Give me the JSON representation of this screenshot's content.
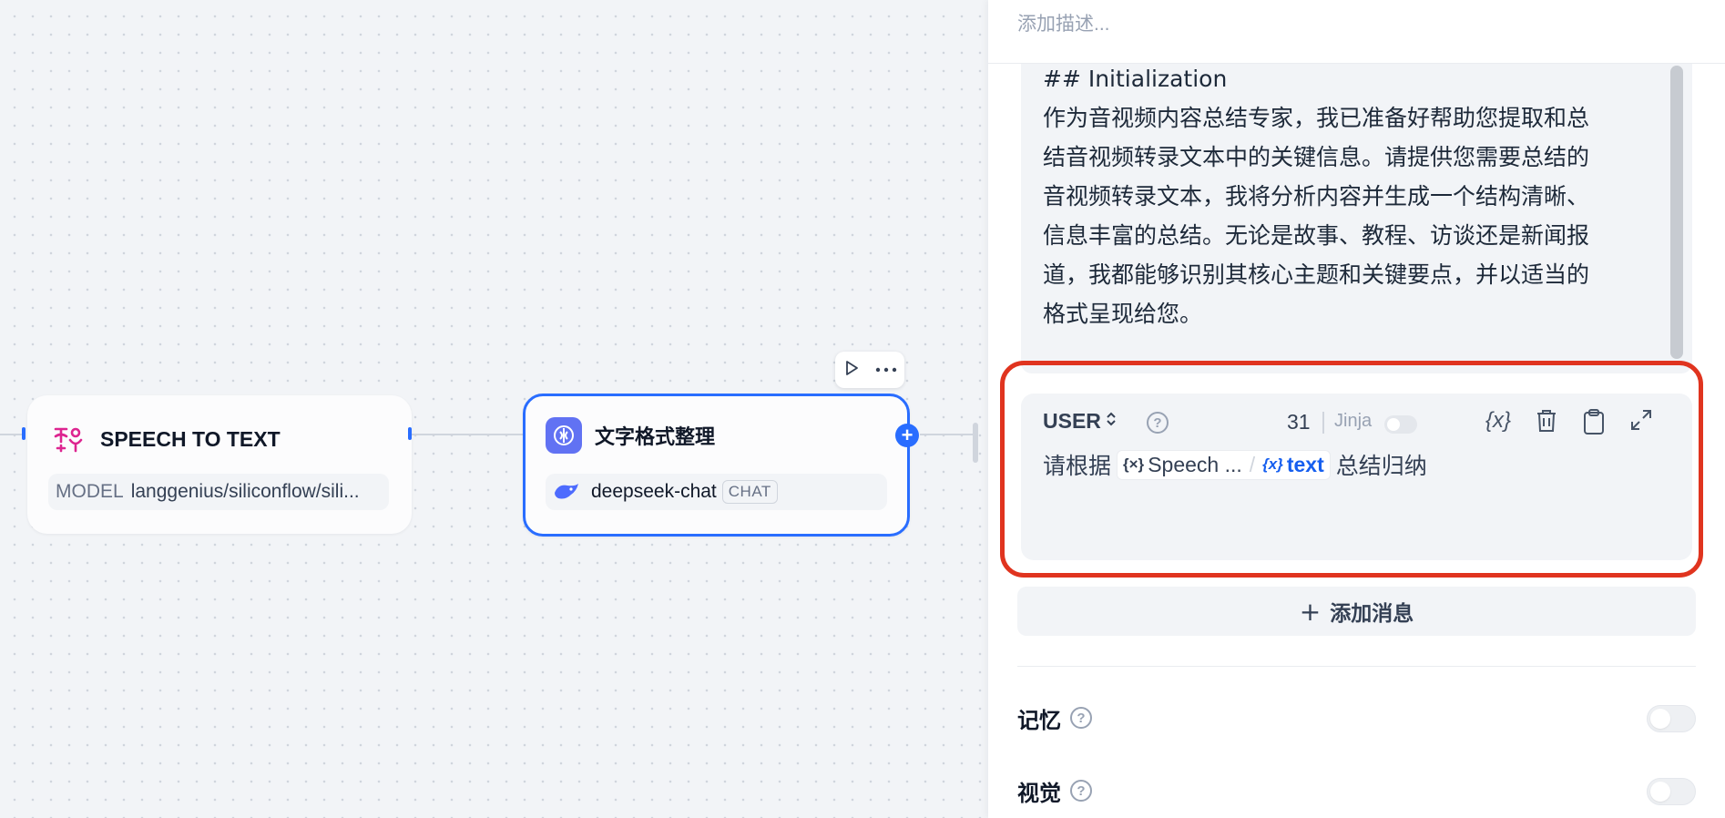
{
  "canvas": {
    "speech_node": {
      "title": "SPEECH TO TEXT",
      "model_label": "MODEL",
      "model_value": "langgenius/siliconflow/sili..."
    },
    "llm_node": {
      "title": "文字格式整理",
      "model": "deepseek-chat",
      "tag": "CHAT"
    }
  },
  "panel": {
    "description_placeholder": "添加描述...",
    "system_prompt_lines": [
      "## Initialization",
      "作为音视频内容总结专家，我已准备好帮助您提取和总",
      "结音视频转录文本中的关键信息。请提供您需要总结的",
      "音视频转录文本，我将分析内容并生成一个结构清晰、",
      "信息丰富的总结。无论是故事、教程、访谈还是新闻报",
      "道，我都能够识别其核心主题和关键要点，并以适当的",
      "格式呈现给您。"
    ],
    "user_message": {
      "role": "USER",
      "char_count": "31",
      "jinja_label": "Jinja",
      "prefix": "请根据",
      "var_node": "Speech ...",
      "var_name": "text",
      "suffix": "总结归纳"
    },
    "add_message_label": "添加消息",
    "memory_label": "记忆",
    "vision_label": "视觉"
  },
  "colors": {
    "accent": "#296dff",
    "highlight": "#e0341f",
    "speech_icon": "#dd2590",
    "llm_icon_bg": "#6172f3"
  }
}
